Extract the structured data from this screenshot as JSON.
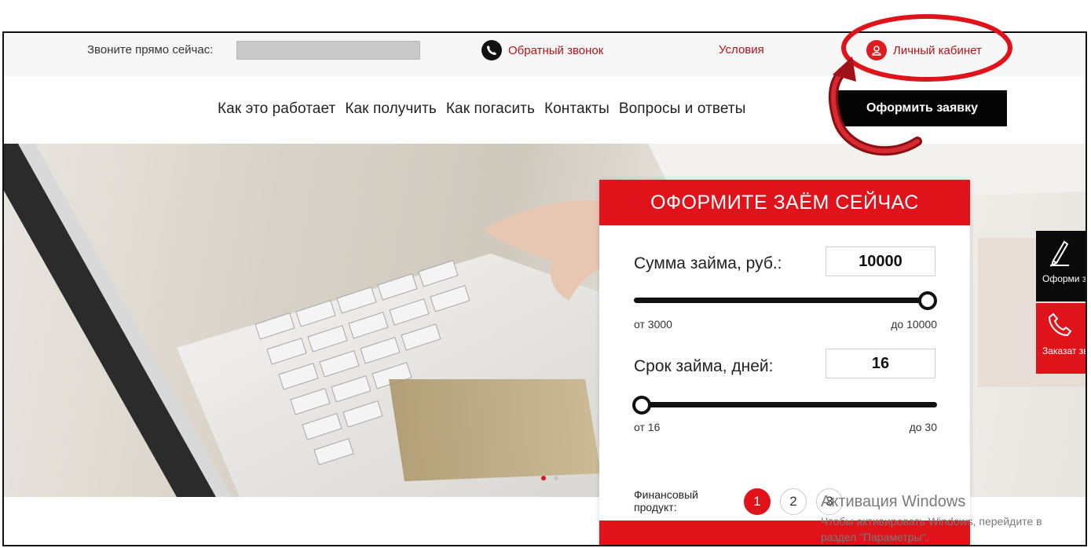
{
  "topbar": {
    "call_label": "Звоните прямо сейчас:",
    "callback_label": "Обратный звонок",
    "conditions_label": "Условия",
    "cabinet_label": "Личный кабинет"
  },
  "nav": {
    "items": [
      "Как это работает",
      "Как получить",
      "Как погасить",
      "Контакты",
      "Вопросы и ответы"
    ],
    "apply_label": "Оформить заявку"
  },
  "form": {
    "title": "ОФОРМИТЕ ЗАЁМ СЕЙЧАС",
    "amount_label": "Сумма займа, руб.:",
    "amount_value": "10000",
    "amount_min_label": "от 3000",
    "amount_max_label": "до 10000",
    "amount_slider_fraction": 1.0,
    "term_label": "Срок займа, дней:",
    "term_value": "16",
    "term_min_label": "от 16",
    "term_max_label": "до 30",
    "term_slider_fraction": 0.0,
    "product_label": "Финансовый продукт:",
    "products": [
      "1",
      "2",
      "3"
    ],
    "active_product": "1"
  },
  "side": {
    "apply_label": "Оформи заявку",
    "call_label": "Заказат звонок"
  },
  "watermark": {
    "title": "Активация Windows",
    "text": "Чтобы активировать Windows, перейдите в раздел \"Параметры\"."
  },
  "colors": {
    "accent": "#e0131b",
    "link": "#b0141a",
    "dark": "#050505"
  }
}
